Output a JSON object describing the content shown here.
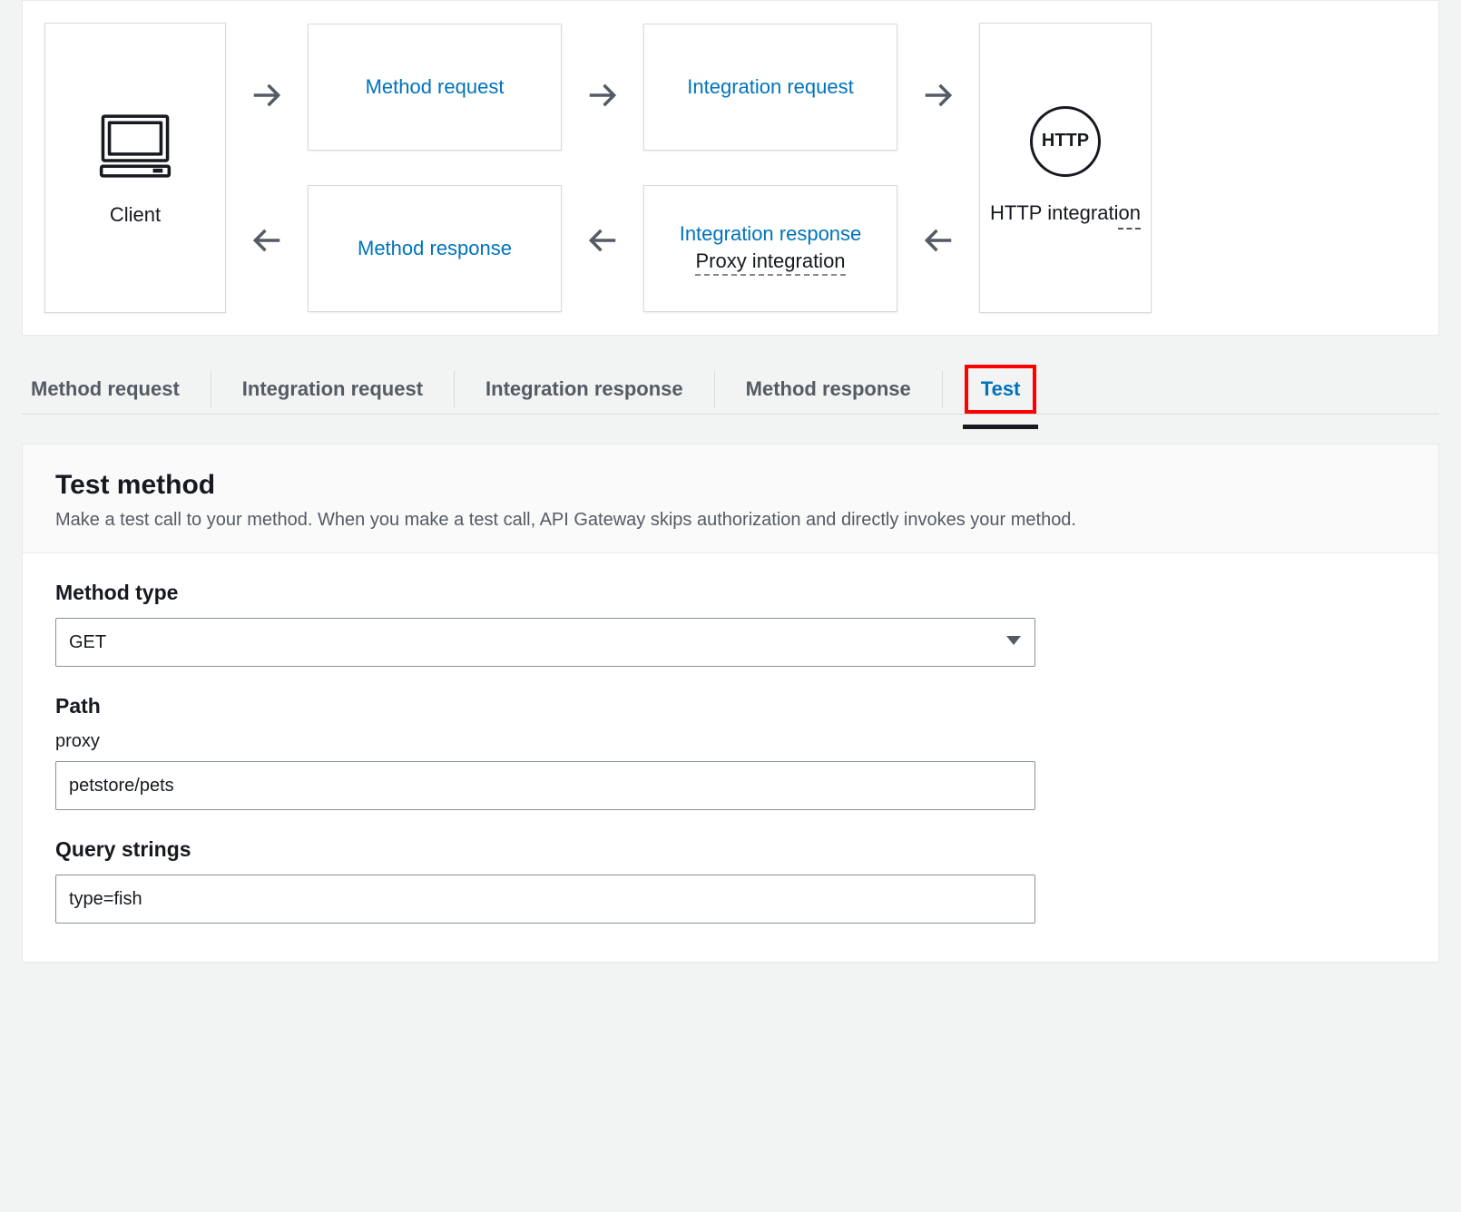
{
  "diagram": {
    "client_label": "Client",
    "method_request": "Method request",
    "integration_request": "Integration request",
    "method_response": "Method response",
    "integration_response": "Integration response",
    "proxy_integration": "Proxy integration",
    "http_badge": "HTTP",
    "http_integration_label": "HTTP integration"
  },
  "tabs": {
    "method_request": "Method request",
    "integration_request": "Integration request",
    "integration_response": "Integration response",
    "method_response": "Method response",
    "test": "Test"
  },
  "test_panel": {
    "title": "Test method",
    "description": "Make a test call to your method. When you make a test call, API Gateway skips authorization and directly invokes your method.",
    "method_type_label": "Method type",
    "method_type_value": "GET",
    "path_label": "Path",
    "proxy_label": "proxy",
    "proxy_value": "petstore/pets",
    "query_strings_label": "Query strings",
    "query_strings_value": "type=fish"
  }
}
